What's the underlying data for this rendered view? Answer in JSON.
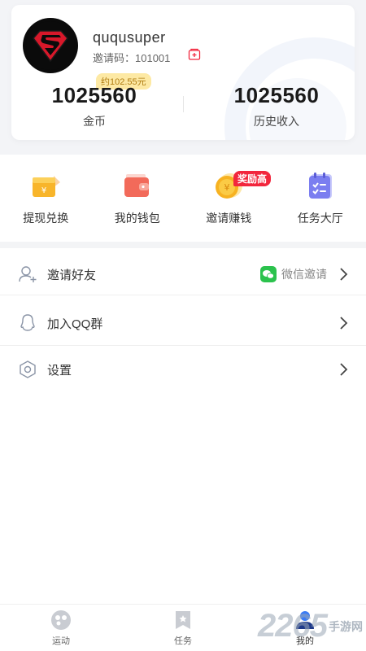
{
  "profile": {
    "username": "ququsuper",
    "invite_code": "邀请码：101001",
    "coins": {
      "value": "1025560",
      "label": "金币",
      "approx_badge": "约102.55元"
    },
    "income": {
      "value": "1025560",
      "label": "历史收入"
    }
  },
  "quick_actions": [
    {
      "label": "提现兑换",
      "icon": "cash-box-icon"
    },
    {
      "label": "我的钱包",
      "icon": "wallet-icon"
    },
    {
      "label": "邀请赚钱",
      "icon": "coin-icon",
      "badge": "奖励高"
    },
    {
      "label": "任务大厅",
      "icon": "checklist-icon"
    }
  ],
  "menu": [
    {
      "label": "邀请好友",
      "icon": "add-user-icon",
      "extra": "微信邀请",
      "extra_icon": "wechat-icon"
    },
    {
      "label": "加入QQ群",
      "icon": "qq-icon"
    },
    {
      "label": "设置",
      "icon": "settings-hexagon-icon"
    }
  ],
  "tabs": [
    {
      "label": "运动",
      "icon": "sport-icon"
    },
    {
      "label": "任务",
      "icon": "task-flag-icon"
    },
    {
      "label": "我的",
      "icon": "user-icon",
      "active": true
    }
  ],
  "watermark": {
    "number": "2265",
    "text": "手游网"
  },
  "colors": {
    "accent_red": "#f2263d",
    "badge_yellow": "#fde9a4",
    "wechat_green": "#2bc24d",
    "active_blue": "#3a7bf5"
  }
}
